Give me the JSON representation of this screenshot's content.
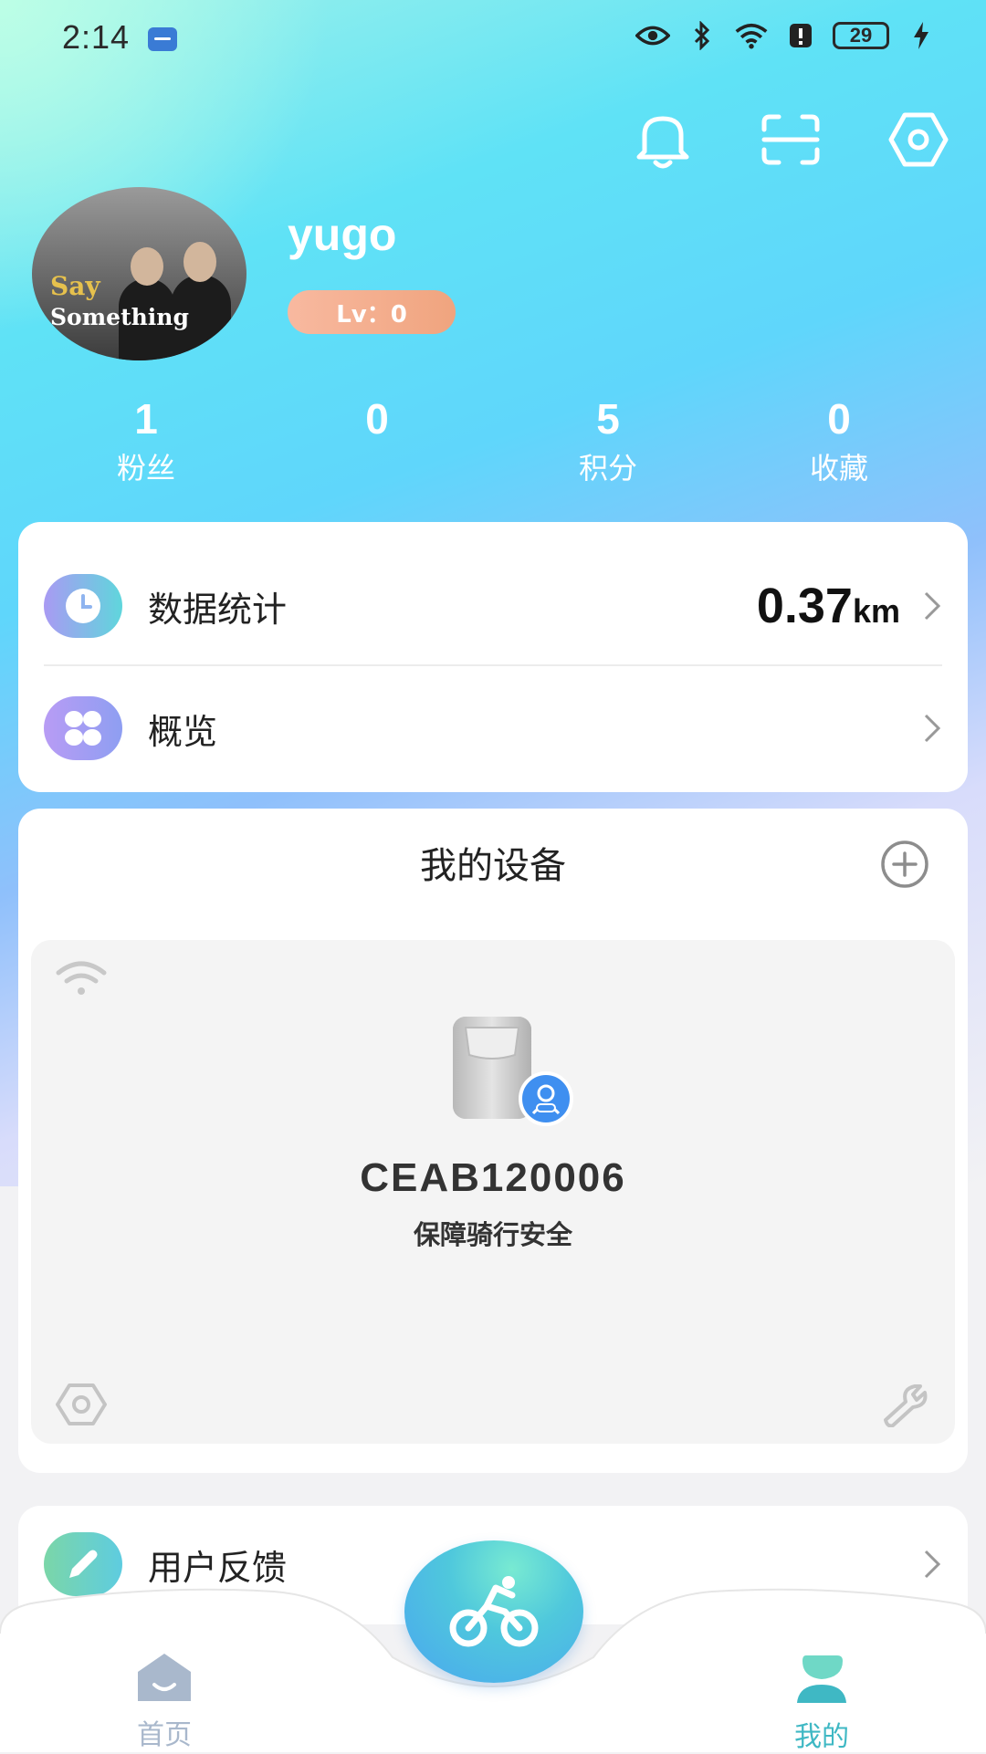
{
  "status_bar": {
    "time": "2:14",
    "battery": "29"
  },
  "profile": {
    "username": "yugo",
    "level": "Lv：0",
    "avatar_text_1": "Say",
    "avatar_text_2": "Something"
  },
  "stats": [
    {
      "value": "1",
      "label": "粉丝"
    },
    {
      "value": "0",
      "label": ""
    },
    {
      "value": "5",
      "label": "积分"
    },
    {
      "value": "0",
      "label": "收藏"
    }
  ],
  "menu": {
    "data_stats_label": "数据统计",
    "data_stats_value": "0.37",
    "data_stats_unit": "km",
    "overview_label": "概览"
  },
  "devices": {
    "title": "我的设备",
    "device_name": "CEAB120006",
    "device_subtitle": "保障骑行安全"
  },
  "feedback": {
    "label": "用户反馈"
  },
  "nav": {
    "home_label": "首页",
    "mine_label": "我的",
    "active_color": "#3fb8c4",
    "inactive_color": "#a9b8cc"
  }
}
